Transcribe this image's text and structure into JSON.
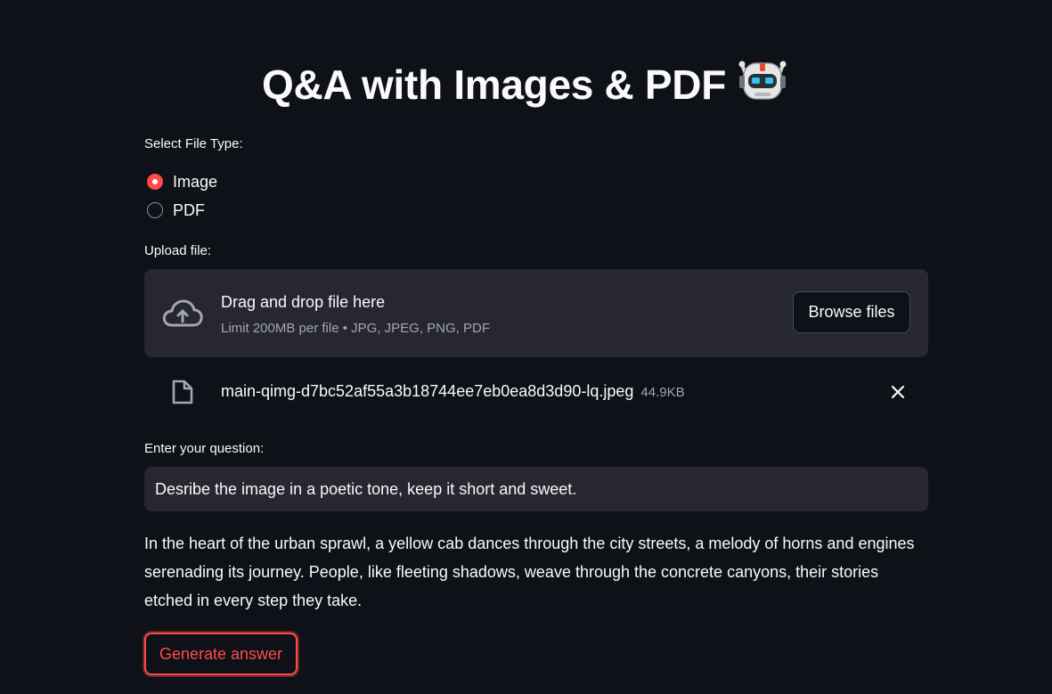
{
  "app": {
    "title": "Q&A with Images & PDF",
    "title_icon": "robot-icon"
  },
  "file_type": {
    "label": "Select File Type:",
    "options": [
      {
        "label": "Image",
        "selected": true
      },
      {
        "label": "PDF",
        "selected": false
      }
    ]
  },
  "upload": {
    "label": "Upload file:",
    "drop_text": "Drag and drop file here",
    "limit_text": "Limit 200MB per file • JPG, JPEG, PNG, PDF",
    "browse_label": "Browse files",
    "icon": "cloud-upload-icon"
  },
  "uploaded_file": {
    "name": "main-qimg-d7bc52af55a3b18744ee7eb0ea8d3d90-lq.jpeg",
    "size": "44.9KB",
    "icon": "file-icon"
  },
  "question": {
    "label": "Enter your question:",
    "value": "Desribe the image in a poetic tone, keep it short and sweet."
  },
  "answer": {
    "text": "In the heart of the urban sprawl, a yellow cab dances through the city streets, a melody of horns and engines serenading its journey. People, like fleeting shadows, weave through the concrete canyons, their stories etched in every step they take."
  },
  "actions": {
    "generate_label": "Generate answer"
  },
  "colors": {
    "background": "#0e1117",
    "surface": "#262730",
    "accent": "#ff4b4b",
    "text": "#fafafa",
    "muted": "#a3a6b0"
  }
}
